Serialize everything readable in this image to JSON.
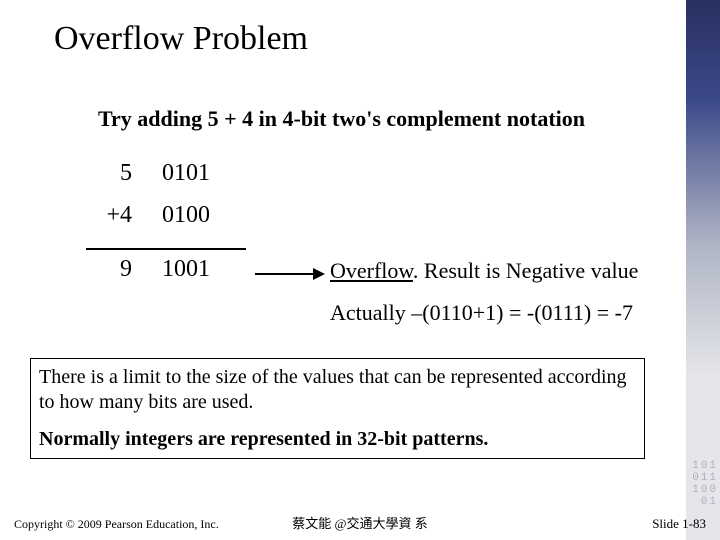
{
  "title": "Overflow Problem",
  "subtitle": "Try adding 5 + 4 in 4-bit two's complement notation",
  "calc": {
    "row1": {
      "dec": "5",
      "bin": "0101"
    },
    "row2": {
      "dec": "+4",
      "bin": "0100"
    },
    "result": {
      "dec": "9",
      "bin": "1001"
    }
  },
  "overflow": {
    "word": "Overflow",
    "rest": ". Result is Negative value"
  },
  "actually": "Actually –(0110+1) = -(0111) = -7",
  "limit": {
    "line1": "There is a limit to the size of the values that can be represented according to how many bits are used.",
    "line2": "Normally integers are represented in 32-bit patterns."
  },
  "footer": {
    "copyright": "Copyright © 2009 Pearson Education, Inc.",
    "center": "蔡文能 @交通大學資 系",
    "slidenum": "Slide 1-83"
  },
  "bgbits": "101\n011\n100\n01"
}
